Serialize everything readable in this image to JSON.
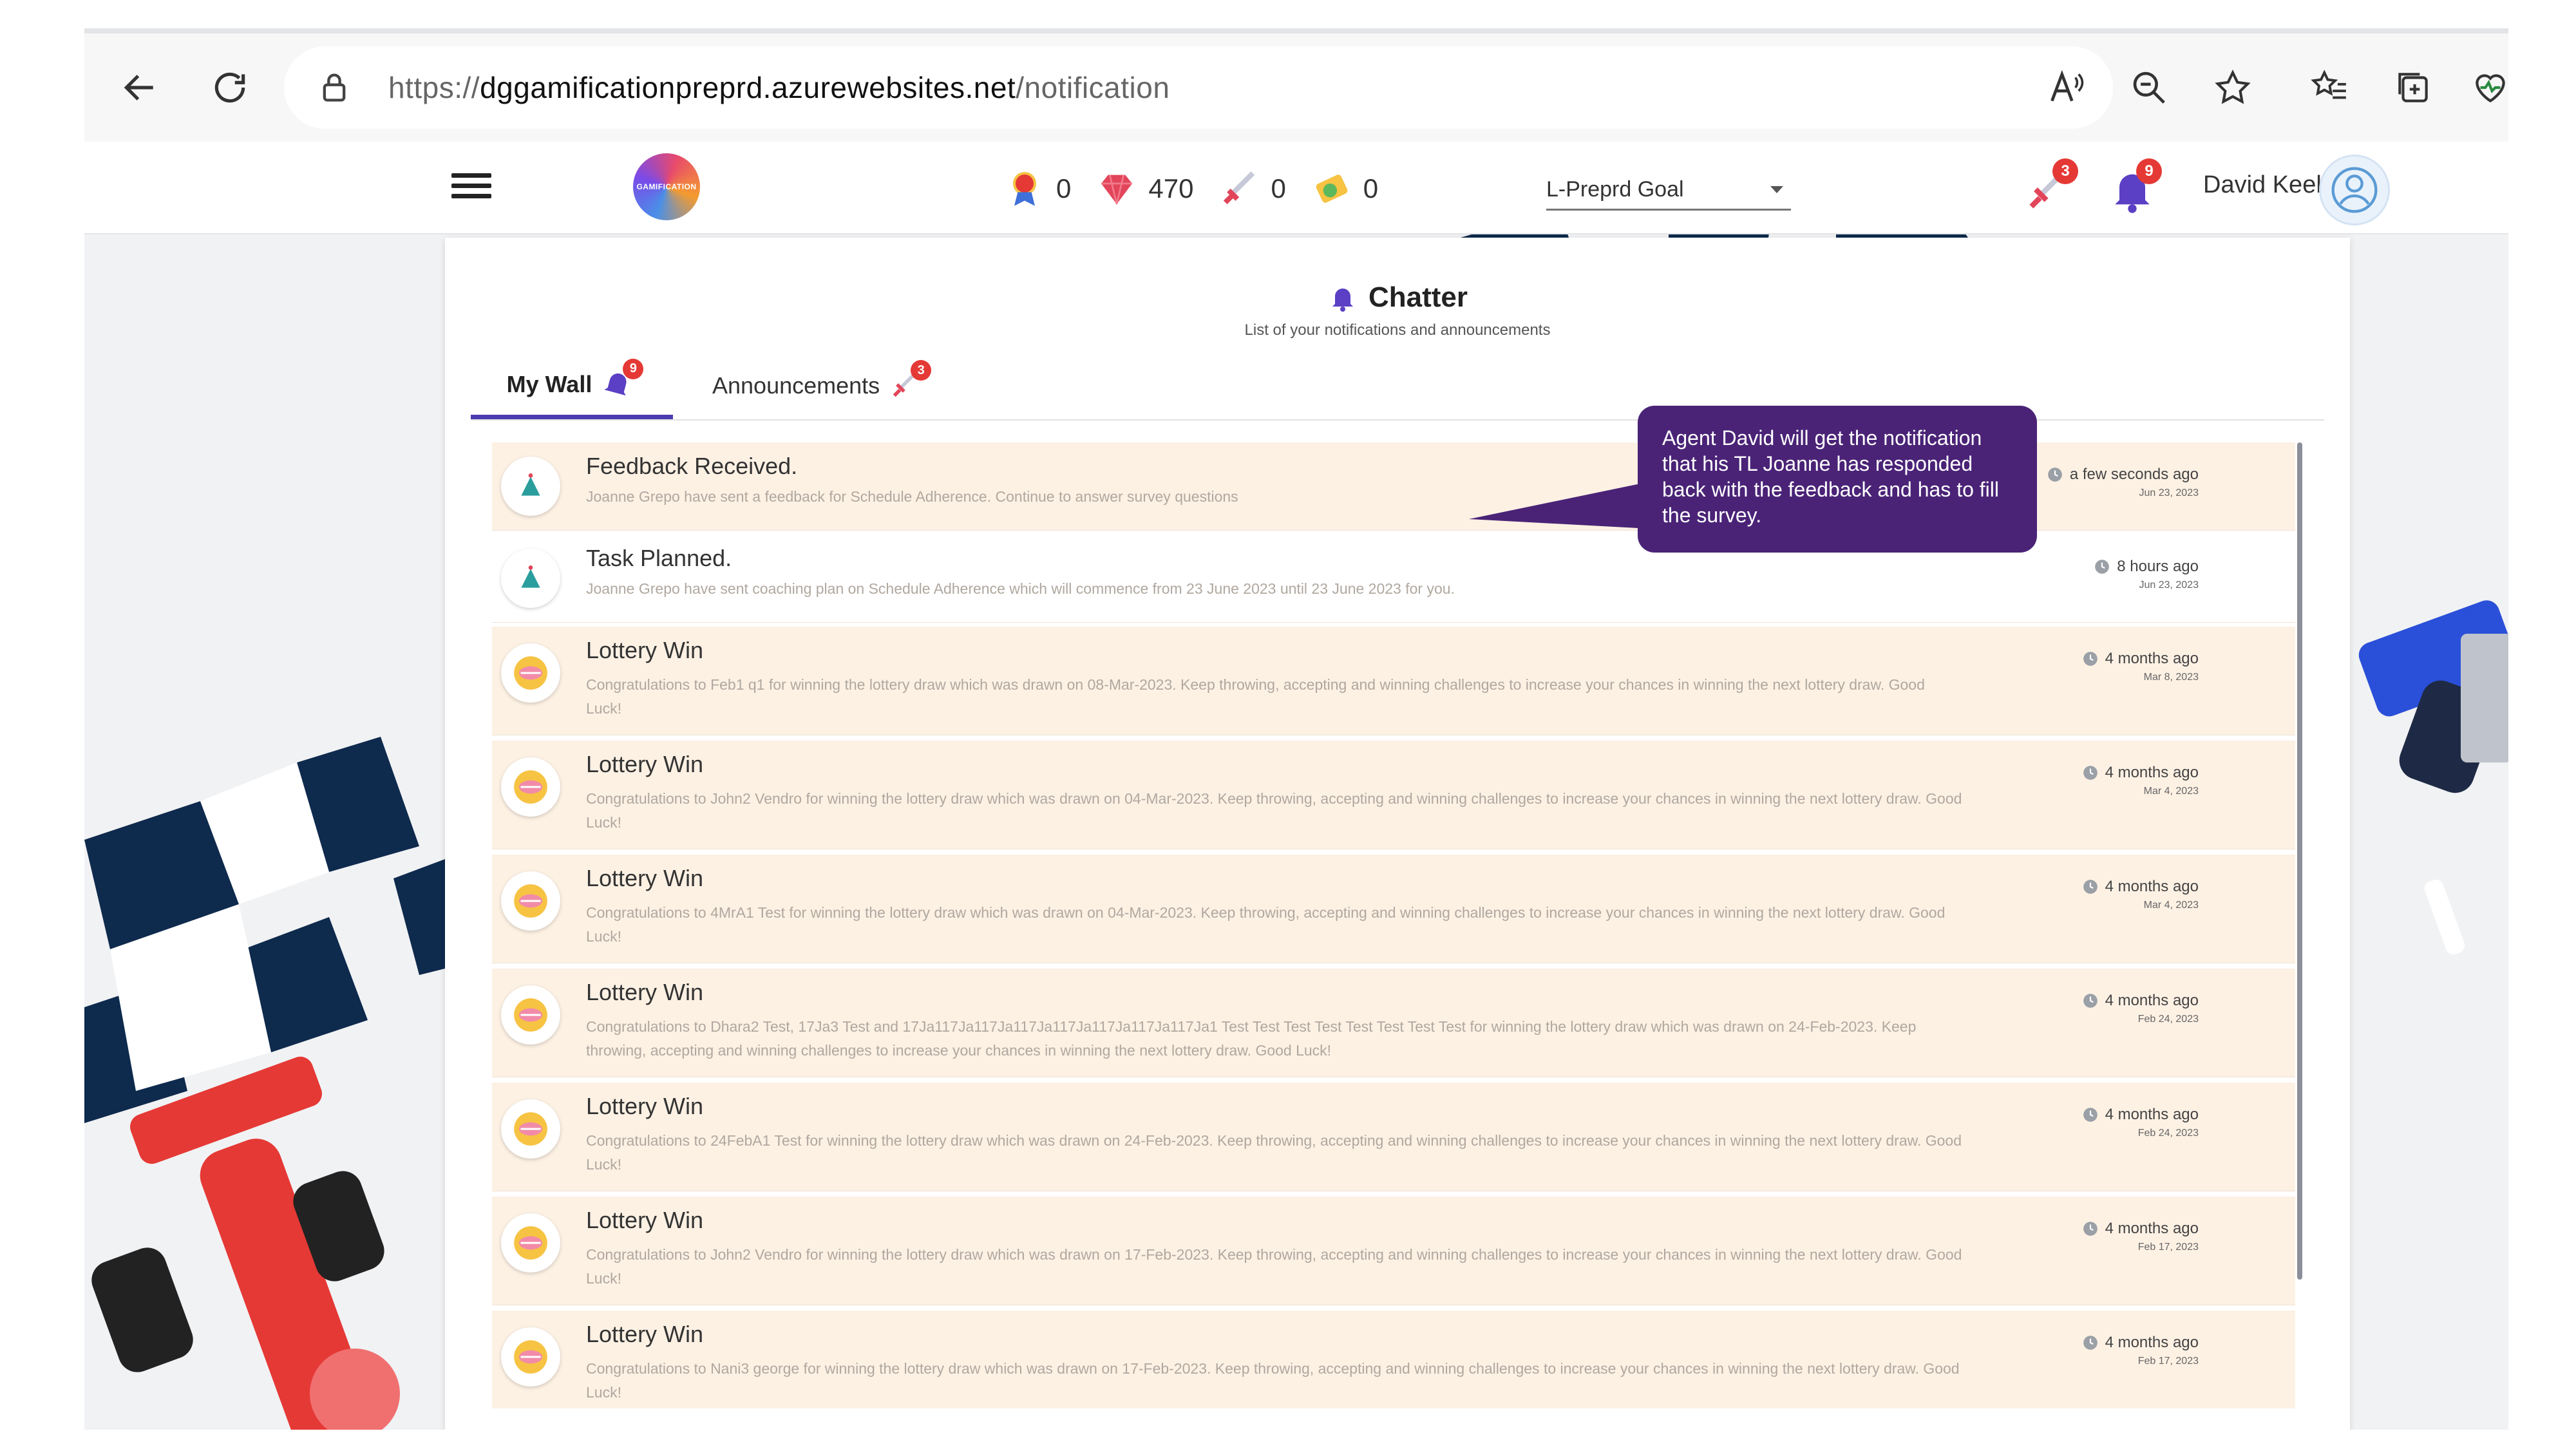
{
  "browser": {
    "url_proto": "https://",
    "url_host": "dggamificationpreprd.azurewebsites.net",
    "url_path": "/notification",
    "icons": [
      "back-icon",
      "refresh-icon",
      "lock-icon",
      "read-aloud-icon",
      "zoom-out-icon",
      "favorite-star-icon",
      "favorites-icon",
      "collections-icon",
      "health-icon"
    ]
  },
  "header": {
    "logo_text": "GAMIFICATION",
    "stats": [
      {
        "icon": "badge-icon",
        "value": "0"
      },
      {
        "icon": "gem-icon",
        "value": "470"
      },
      {
        "icon": "sword-icon",
        "value": "0"
      },
      {
        "icon": "token-icon",
        "value": "0"
      }
    ],
    "goal_select": "L-Preprd Goal",
    "challenge_badge": "3",
    "notification_badge": "9",
    "user_name": "David Keel"
  },
  "chatter": {
    "title": "Chatter",
    "subtitle": "List of your notifications and announcements",
    "tabs": [
      {
        "label": "My Wall",
        "badge": "9"
      },
      {
        "label": "Announcements",
        "badge": "3"
      }
    ]
  },
  "notifications": [
    {
      "title": "Feedback Received.",
      "body": "Joanne Grepo have sent a feedback for Schedule Adherence. Continue to answer survey questions",
      "time": "a few seconds ago",
      "date": "Jun 23, 2023",
      "icon": "feedback-icon"
    },
    {
      "title": "Task Planned.",
      "body": "Joanne Grepo have sent coaching plan on Schedule Adherence which will commence from 23 June 2023 until 23 June 2023 for you.",
      "time": "8 hours ago",
      "date": "Jun 23, 2023",
      "icon": "task-icon"
    },
    {
      "title": "Lottery Win",
      "body": "Congratulations to Feb1 q1 for winning the lottery draw which was drawn on 08-Mar-2023. Keep throwing, accepting and winning challenges to increase your chances in winning the next lottery draw. Good Luck!",
      "time": "4 months ago",
      "date": "Mar 8, 2023",
      "icon": "lottery-icon"
    },
    {
      "title": "Lottery Win",
      "body": "Congratulations to John2 Vendro for winning the lottery draw which was drawn on 04-Mar-2023. Keep throwing, accepting and winning challenges to increase your chances in winning the next lottery draw. Good Luck!",
      "time": "4 months ago",
      "date": "Mar 4, 2023",
      "icon": "lottery-icon"
    },
    {
      "title": "Lottery Win",
      "body": "Congratulations to 4MrA1 Test for winning the lottery draw which was drawn on 04-Mar-2023. Keep throwing, accepting and winning challenges to increase your chances in winning the next lottery draw. Good Luck!",
      "time": "4 months ago",
      "date": "Mar 4, 2023",
      "icon": "lottery-icon"
    },
    {
      "title": "Lottery Win",
      "body": "Congratulations to Dhara2 Test, 17Ja3 Test and 17Ja117Ja117Ja117Ja117Ja117Ja117Ja117Ja1 Test Test Test Test Test Test Test Test for winning the lottery draw which was drawn on 24-Feb-2023. Keep throwing, accepting and winning challenges to increase your chances in winning the next lottery draw. Good Luck!",
      "time": "4 months ago",
      "date": "Feb 24, 2023",
      "icon": "lottery-icon"
    },
    {
      "title": "Lottery Win",
      "body": "Congratulations to 24FebA1 Test for winning the lottery draw which was drawn on 24-Feb-2023. Keep throwing, accepting and winning challenges to increase your chances in winning the next lottery draw. Good Luck!",
      "time": "4 months ago",
      "date": "Feb 24, 2023",
      "icon": "lottery-icon"
    },
    {
      "title": "Lottery Win",
      "body": "Congratulations to John2 Vendro for winning the lottery draw which was drawn on 17-Feb-2023. Keep throwing, accepting and winning challenges to increase your chances in winning the next lottery draw. Good Luck!",
      "time": "4 months ago",
      "date": "Feb 17, 2023",
      "icon": "lottery-icon"
    },
    {
      "title": "Lottery Win",
      "body": "Congratulations to Nani3 george for winning the lottery draw which was drawn on 17-Feb-2023. Keep throwing, accepting and winning challenges to increase your chances in winning the next lottery draw. Good Luck!",
      "time": "4 months ago",
      "date": "Feb 17, 2023",
      "icon": "lottery-icon"
    }
  ],
  "callout": {
    "text": "Agent David will get the notification that his TL Joanne has responded back with the feedback and has to fill the survey."
  },
  "colors": {
    "accent": "#4b3bb0",
    "row_highlight": "#fdf1e4",
    "badge": "#e53935",
    "callout": "#4a2377"
  }
}
